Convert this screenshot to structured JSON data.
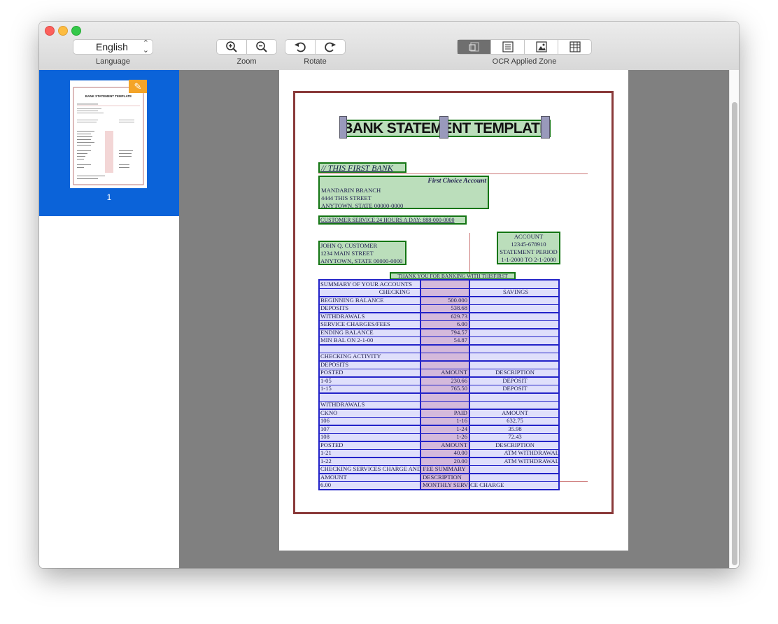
{
  "toolbar": {
    "language_label": "Language",
    "language_value": "English",
    "zoom_label": "Zoom",
    "rotate_label": "Rotate",
    "ocr_zone_label": "OCR Applied Zone",
    "icons": [
      "zoom-in-icon",
      "zoom-out-icon",
      "rotate-left-icon",
      "rotate-right-icon",
      "zone-auto-icon",
      "zone-text-icon",
      "zone-image-icon",
      "zone-table-icon"
    ]
  },
  "sidebar": {
    "page_number": "1",
    "thumb_title": "BANK STATEMENT TEMPLATE"
  },
  "colors": {
    "selection": "#0b63d9",
    "text_zone": "#137513",
    "table_zone": "#2323c8",
    "canvas": "#808080"
  },
  "document": {
    "title": "BANK STATEMENT TEMPLATE",
    "bank_name": "// THIS FIRST BANK",
    "account_type": "First Choice Account",
    "branch_lines": [
      "MANDARIN BRANCH",
      "4444 THIS STREET",
      "ANYTOWN, STATE 00000-0000"
    ],
    "customer_service": "CUSTOMER SERVICE 24 HOURS A DAY: 888-000-0000",
    "customer_lines": [
      "JOHN Q. CUSTOMER",
      "1234 MAIN STREET",
      "ANYTOWN, STATE 00000-0000"
    ],
    "account_lines": [
      "ACCOUNT",
      "12345-678910",
      "STATEMENT PERIOD",
      "1-1-2000 TO 2-1-2000"
    ],
    "thanks": "THANK YOU FOR BANKING WITH THISFIRST",
    "rows": [
      [
        "SUMMARY OF YOUR ACCOUNTS",
        "",
        ""
      ],
      [
        "CHECKING",
        "",
        "SAVINGS"
      ],
      [
        "BEGINNING BALANCE",
        "500.000",
        ""
      ],
      [
        "DEPOSITS",
        "538.68",
        ""
      ],
      [
        "WITHDRAWALS",
        "629.73",
        ""
      ],
      [
        "SERVICE CHARGES/FEES",
        "6.00",
        ""
      ],
      [
        "ENDING BALANCE",
        "794.57",
        ""
      ],
      [
        "MIN BAL ON 2-1-00",
        "54.87",
        ""
      ],
      [
        "",
        "",
        ""
      ],
      [
        "CHECKING ACTIVITY",
        "",
        ""
      ],
      [
        "DEPOSITS",
        "",
        ""
      ],
      [
        "POSTED",
        "AMOUNT",
        "DESCRIPTION"
      ],
      [
        "1-05",
        "230.66",
        "DEPOSIT"
      ],
      [
        "1-15",
        "765.50",
        "DEPOSIT"
      ],
      [
        "",
        "",
        ""
      ],
      [
        "WITHDRAWALS",
        "",
        ""
      ],
      [
        "CKNO",
        "PAID",
        "AMOUNT"
      ],
      [
        "106",
        "1-16",
        "632.75"
      ],
      [
        "107",
        "1-24",
        "35.98"
      ],
      [
        "108",
        "1-26",
        "72.43"
      ],
      [
        "POSTED",
        "AMOUNT",
        "DESCRIPTION"
      ],
      [
        "1-21",
        "40.00",
        "ATM WITHDRAWAL"
      ],
      [
        "1-22",
        "20.00",
        "ATM WITHDRAWAL"
      ],
      [
        "CHECKING SERVICES CHARGE AND FEE SUMMARY",
        "",
        ""
      ],
      [
        "AMOUNT",
        "DESCRIPTION",
        ""
      ],
      [
        "6.00",
        "MONTHLY SERVICE CHARGE",
        ""
      ]
    ]
  }
}
